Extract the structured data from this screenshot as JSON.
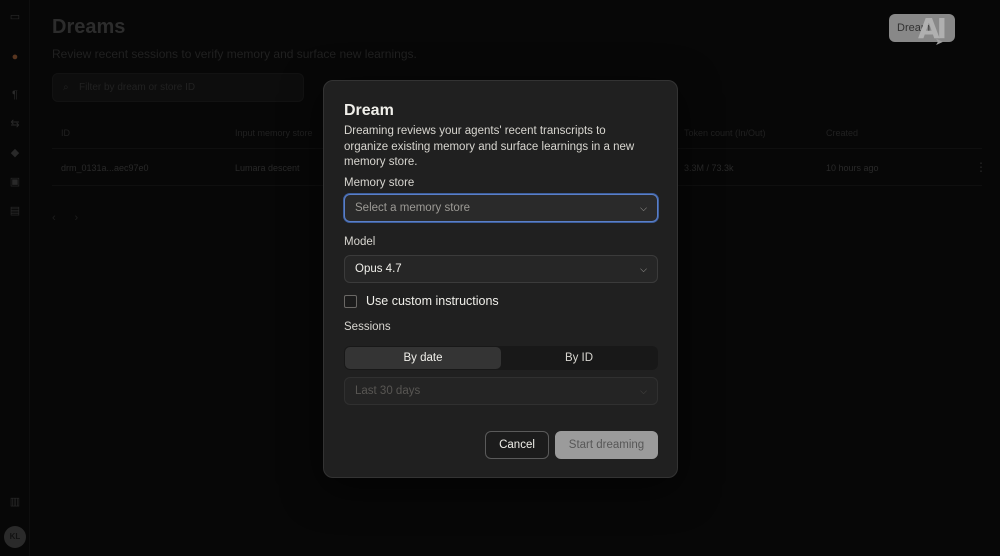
{
  "page": {
    "title": "Dreams",
    "subtitle": "Review recent sessions to verify memory and surface new learnings.",
    "filter_placeholder": "Filter by dream or store ID",
    "new_button_label": "Dream",
    "brand_logo": "AI"
  },
  "table": {
    "headers": [
      "ID",
      "Input memory store",
      "Token count (In/Out)",
      "Created"
    ],
    "rows": [
      {
        "id": "drm_0131a...aec97e0",
        "store": "Lumara descent",
        "tokens": "3.3M / 73.3k",
        "created": "10 hours ago"
      }
    ]
  },
  "pager": {
    "prev": "‹",
    "next": "›"
  },
  "user": {
    "initials": "KL"
  },
  "modal": {
    "title": "Dream",
    "description": "Dreaming reviews your agents' recent transcripts to organize existing memory and surface learnings in a new memory store.",
    "memory_store": {
      "label": "Memory store",
      "placeholder": "Select a memory store"
    },
    "model": {
      "label": "Model",
      "value": "Opus 4.7"
    },
    "custom_instructions": {
      "label": "Use custom instructions",
      "checked": false
    },
    "sessions": {
      "label": "Sessions",
      "tabs": [
        "By date",
        "By ID"
      ],
      "active_tab": "By date",
      "range_value": "Last 30 days"
    },
    "cancel_label": "Cancel",
    "submit_label": "Start dreaming"
  },
  "colors": {
    "focus_ring": "#5b7fc7",
    "modal_bg": "#202020",
    "primary_disabled": "#9b9b9b"
  },
  "icons": {
    "chevron": "chevron-down-icon",
    "search": "search-icon",
    "menu": "more-vertical-icon"
  }
}
